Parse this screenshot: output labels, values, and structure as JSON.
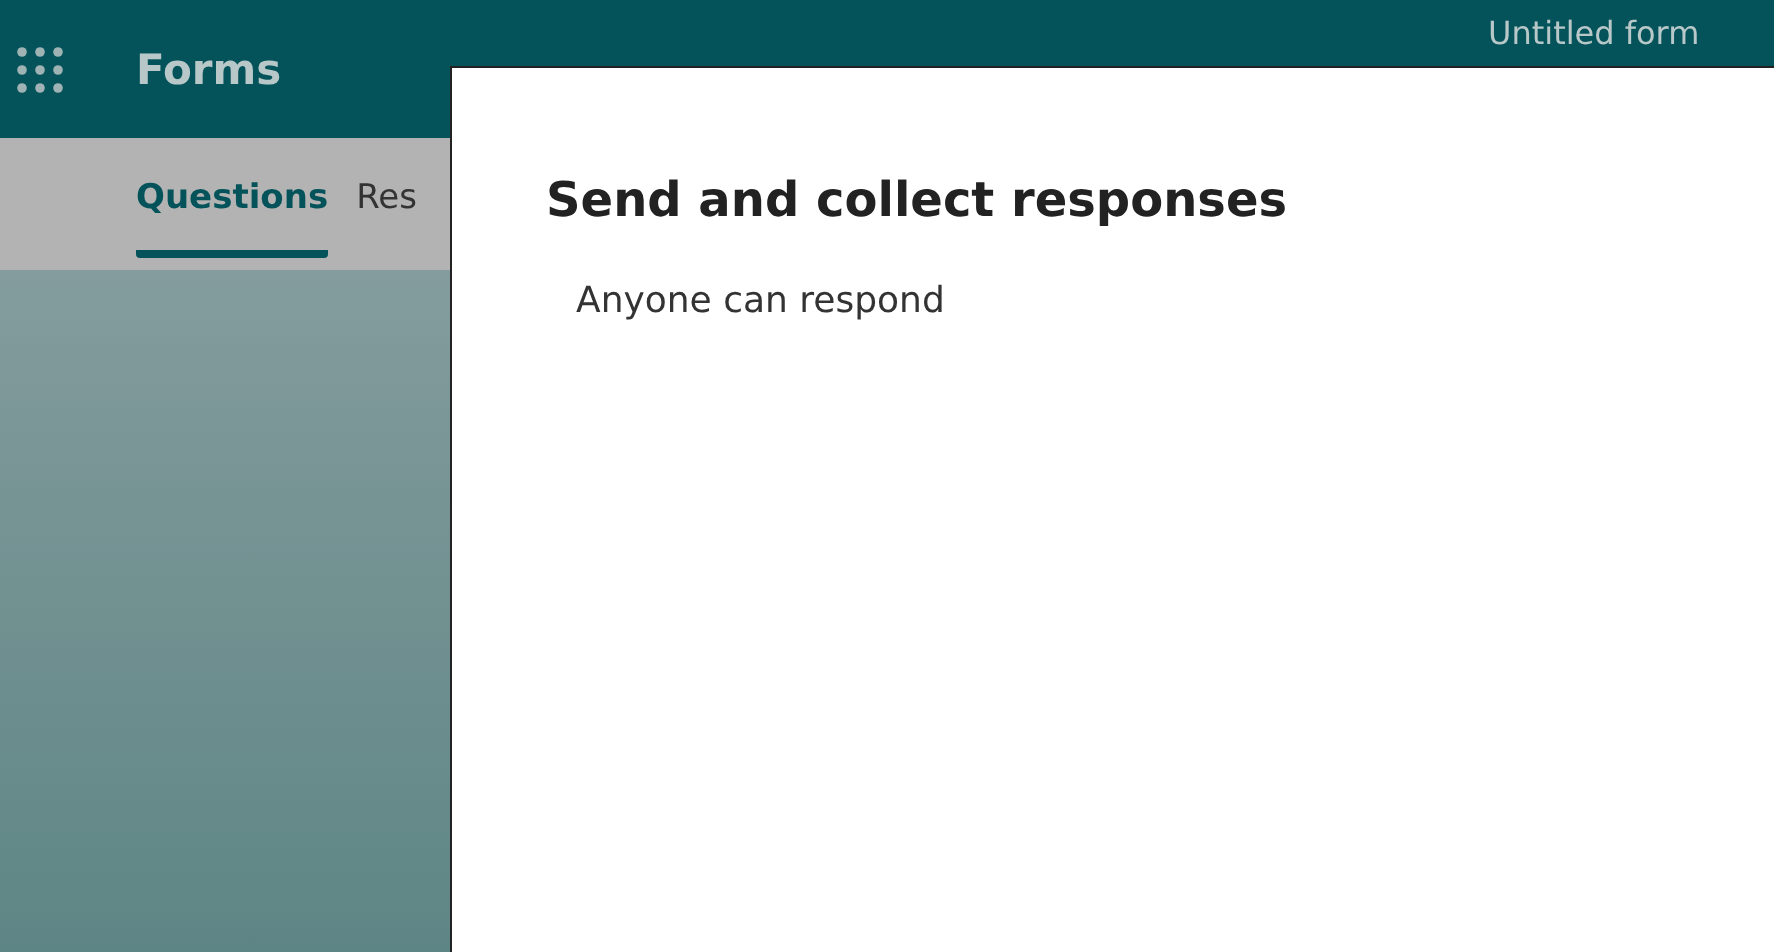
{
  "app_bar": {
    "app_name": "Forms",
    "form_title": "Untitled form"
  },
  "tabs": [
    {
      "label": "Questions",
      "selected": true
    },
    {
      "label": "Res",
      "selected": false
    }
  ],
  "dialog": {
    "title": "Send and collect responses",
    "audience": "Anyone can respond"
  }
}
